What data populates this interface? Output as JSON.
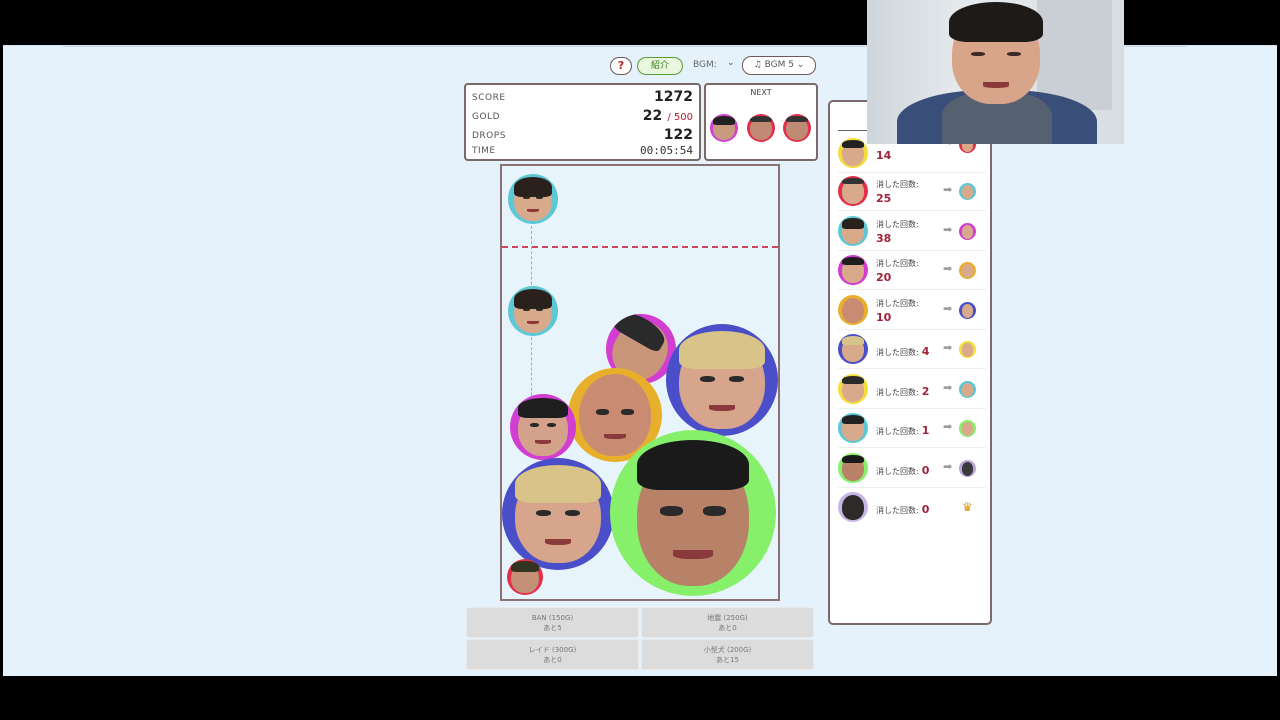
{
  "controls": {
    "help_label": "?",
    "intro_label": "紹介",
    "bgm_label": "BGM:",
    "bgm_volume_arrow": "⌄",
    "bgm_select": "♫ BGM 5 ⌄"
  },
  "score_panel": {
    "score_label": "SCORE",
    "score": "1272",
    "gold_label": "GOLD",
    "gold": "22",
    "gold_max": "/ 500",
    "drops_label": "DROPS",
    "drops": "122",
    "time_label": "TIME",
    "time": "00:05:54"
  },
  "next_panel": {
    "title": "NEXT"
  },
  "colors": {
    "rim_teal": "#5cc8d6",
    "rim_magenta": "#d13ed1",
    "rim_gold": "#e8b02a",
    "rim_blue": "#4a4ec8",
    "rim_green": "#86f06a",
    "rim_red": "#e0304a",
    "rim_yellow": "#f2dd3a",
    "danger_line": "#d2445a",
    "count_value": "#a0233a"
  },
  "actions": [
    {
      "label": "BAN (150G)",
      "sub": "あと5"
    },
    {
      "label": "地震 (250G)",
      "sub": "あと0"
    },
    {
      "label": "レイド (300G)",
      "sub": "あと0"
    },
    {
      "label": "小型犬 (200G)",
      "sub": "あと15"
    }
  ],
  "side_panel": {
    "count_label": "消した回数:",
    "rows": [
      {
        "count": "14"
      },
      {
        "count": "25"
      },
      {
        "count": "38"
      },
      {
        "count": "20"
      },
      {
        "count": "10"
      },
      {
        "count": "4"
      },
      {
        "count": "2"
      },
      {
        "count": "1"
      },
      {
        "count": "0"
      },
      {
        "count": "0"
      }
    ],
    "crown_icon": "♛"
  },
  "icons": {
    "arrow": "➡"
  }
}
